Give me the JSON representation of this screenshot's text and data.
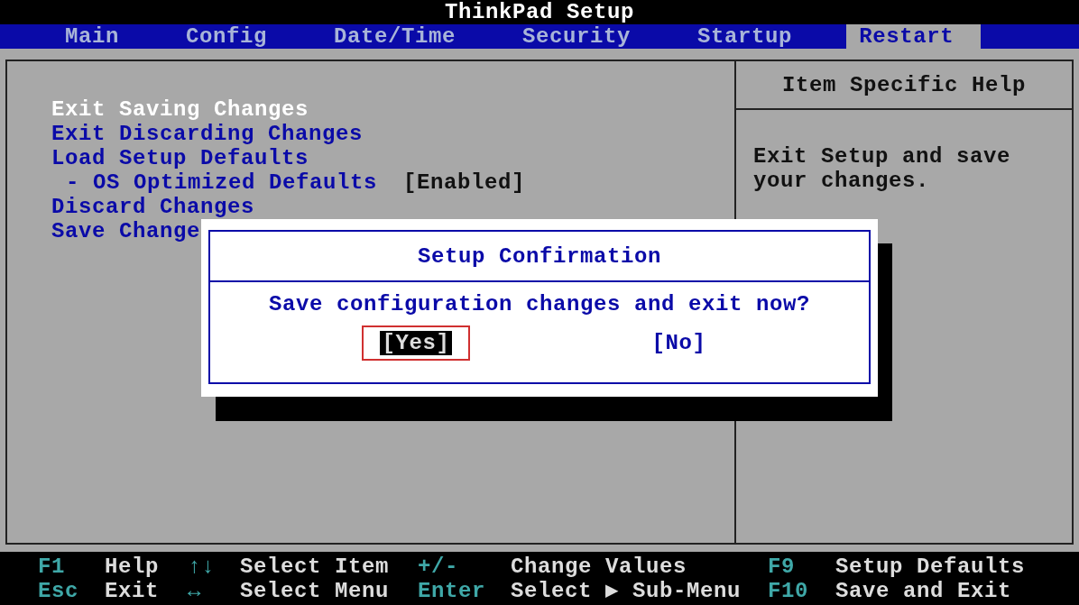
{
  "window": {
    "title": "ThinkPad Setup"
  },
  "tabs": [
    {
      "label": "Main",
      "selected": false
    },
    {
      "label": "Config",
      "selected": false
    },
    {
      "label": "Date/Time",
      "selected": false
    },
    {
      "label": "Security",
      "selected": false
    },
    {
      "label": "Startup",
      "selected": false
    },
    {
      "label": "Restart",
      "selected": true
    }
  ],
  "menu": [
    {
      "label": "Exit Saving Changes",
      "selected": true
    },
    {
      "label": "Exit Discarding Changes",
      "selected": false
    },
    {
      "label": "Load Setup Defaults",
      "selected": false,
      "children": [
        {
          "label": "- OS Optimized Defaults",
          "value": "[Enabled]",
          "selected": false
        }
      ]
    },
    {
      "label": "Discard Changes",
      "selected": false
    },
    {
      "label": "Save Change",
      "selected": false
    }
  ],
  "help": {
    "title": "Item Specific Help",
    "text": "Exit Setup and save your changes."
  },
  "dialog": {
    "title": "Setup Confirmation",
    "message": "Save configuration changes and exit now?",
    "buttons": [
      {
        "label": "[Yes]",
        "selected": true
      },
      {
        "label": "[No]",
        "selected": false
      }
    ]
  },
  "footer": [
    [
      {
        "key": "F1",
        "action": "Help"
      },
      {
        "key": "↑↓",
        "action": "Select Item"
      },
      {
        "key": "+/-",
        "action": "Change Values"
      },
      {
        "key": "F9",
        "action": "Setup Defaults"
      }
    ],
    [
      {
        "key": "Esc",
        "action": "Exit"
      },
      {
        "key": "↔",
        "action": "Select Menu"
      },
      {
        "key": "Enter",
        "action": "Select ▶ Sub-Menu"
      },
      {
        "key": "F10",
        "action": "Save and Exit"
      }
    ]
  ]
}
